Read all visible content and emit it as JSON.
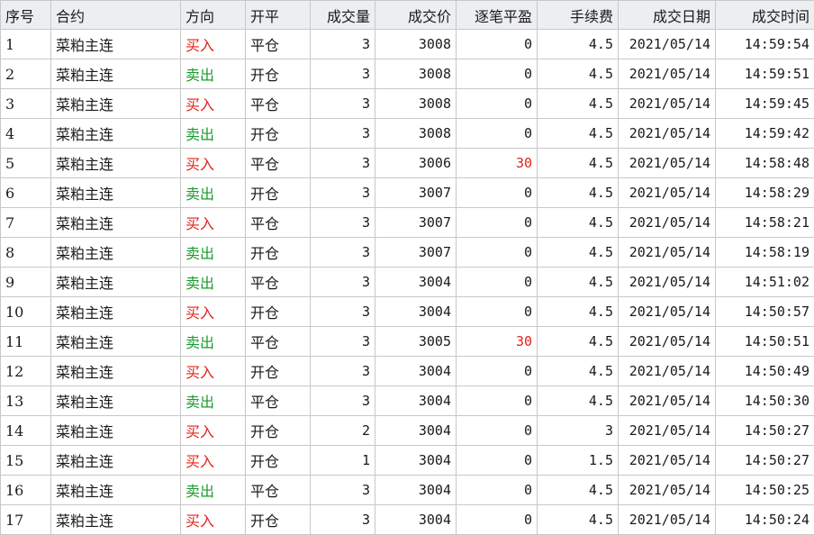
{
  "columns": {
    "seq": "序号",
    "contract": "合约",
    "direction": "方向",
    "offset": "开平",
    "qty": "成交量",
    "price": "成交价",
    "pnl": "逐笔平盈",
    "fee": "手续费",
    "date": "成交日期",
    "time": "成交时间"
  },
  "colors": {
    "buy": "#e0241b",
    "sell": "#1c9a2e",
    "header_bg": "#eceef2",
    "grid": "#c8c8c8"
  },
  "rows": [
    {
      "seq": "1",
      "contract": "菜粕主连",
      "direction": "买入",
      "offset": "平仓",
      "qty": "3",
      "price": "3008",
      "pnl": "0",
      "fee": "4.5",
      "date": "2021/05/14",
      "time": "14:59:54"
    },
    {
      "seq": "2",
      "contract": "菜粕主连",
      "direction": "卖出",
      "offset": "开仓",
      "qty": "3",
      "price": "3008",
      "pnl": "0",
      "fee": "4.5",
      "date": "2021/05/14",
      "time": "14:59:51"
    },
    {
      "seq": "3",
      "contract": "菜粕主连",
      "direction": "买入",
      "offset": "平仓",
      "qty": "3",
      "price": "3008",
      "pnl": "0",
      "fee": "4.5",
      "date": "2021/05/14",
      "time": "14:59:45"
    },
    {
      "seq": "4",
      "contract": "菜粕主连",
      "direction": "卖出",
      "offset": "开仓",
      "qty": "3",
      "price": "3008",
      "pnl": "0",
      "fee": "4.5",
      "date": "2021/05/14",
      "time": "14:59:42"
    },
    {
      "seq": "5",
      "contract": "菜粕主连",
      "direction": "买入",
      "offset": "平仓",
      "qty": "3",
      "price": "3006",
      "pnl": "30",
      "fee": "4.5",
      "date": "2021/05/14",
      "time": "14:58:48"
    },
    {
      "seq": "6",
      "contract": "菜粕主连",
      "direction": "卖出",
      "offset": "开仓",
      "qty": "3",
      "price": "3007",
      "pnl": "0",
      "fee": "4.5",
      "date": "2021/05/14",
      "time": "14:58:29"
    },
    {
      "seq": "7",
      "contract": "菜粕主连",
      "direction": "买入",
      "offset": "平仓",
      "qty": "3",
      "price": "3007",
      "pnl": "0",
      "fee": "4.5",
      "date": "2021/05/14",
      "time": "14:58:21"
    },
    {
      "seq": "8",
      "contract": "菜粕主连",
      "direction": "卖出",
      "offset": "开仓",
      "qty": "3",
      "price": "3007",
      "pnl": "0",
      "fee": "4.5",
      "date": "2021/05/14",
      "time": "14:58:19"
    },
    {
      "seq": "9",
      "contract": "菜粕主连",
      "direction": "卖出",
      "offset": "平仓",
      "qty": "3",
      "price": "3004",
      "pnl": "0",
      "fee": "4.5",
      "date": "2021/05/14",
      "time": "14:51:02"
    },
    {
      "seq": "10",
      "contract": "菜粕主连",
      "direction": "买入",
      "offset": "开仓",
      "qty": "3",
      "price": "3004",
      "pnl": "0",
      "fee": "4.5",
      "date": "2021/05/14",
      "time": "14:50:57"
    },
    {
      "seq": "11",
      "contract": "菜粕主连",
      "direction": "卖出",
      "offset": "平仓",
      "qty": "3",
      "price": "3005",
      "pnl": "30",
      "fee": "4.5",
      "date": "2021/05/14",
      "time": "14:50:51"
    },
    {
      "seq": "12",
      "contract": "菜粕主连",
      "direction": "买入",
      "offset": "开仓",
      "qty": "3",
      "price": "3004",
      "pnl": "0",
      "fee": "4.5",
      "date": "2021/05/14",
      "time": "14:50:49"
    },
    {
      "seq": "13",
      "contract": "菜粕主连",
      "direction": "卖出",
      "offset": "平仓",
      "qty": "3",
      "price": "3004",
      "pnl": "0",
      "fee": "4.5",
      "date": "2021/05/14",
      "time": "14:50:30"
    },
    {
      "seq": "14",
      "contract": "菜粕主连",
      "direction": "买入",
      "offset": "开仓",
      "qty": "2",
      "price": "3004",
      "pnl": "0",
      "fee": "3",
      "date": "2021/05/14",
      "time": "14:50:27"
    },
    {
      "seq": "15",
      "contract": "菜粕主连",
      "direction": "买入",
      "offset": "开仓",
      "qty": "1",
      "price": "3004",
      "pnl": "0",
      "fee": "1.5",
      "date": "2021/05/14",
      "time": "14:50:27"
    },
    {
      "seq": "16",
      "contract": "菜粕主连",
      "direction": "卖出",
      "offset": "平仓",
      "qty": "3",
      "price": "3004",
      "pnl": "0",
      "fee": "4.5",
      "date": "2021/05/14",
      "time": "14:50:25"
    },
    {
      "seq": "17",
      "contract": "菜粕主连",
      "direction": "买入",
      "offset": "开仓",
      "qty": "3",
      "price": "3004",
      "pnl": "0",
      "fee": "4.5",
      "date": "2021/05/14",
      "time": "14:50:24"
    }
  ]
}
